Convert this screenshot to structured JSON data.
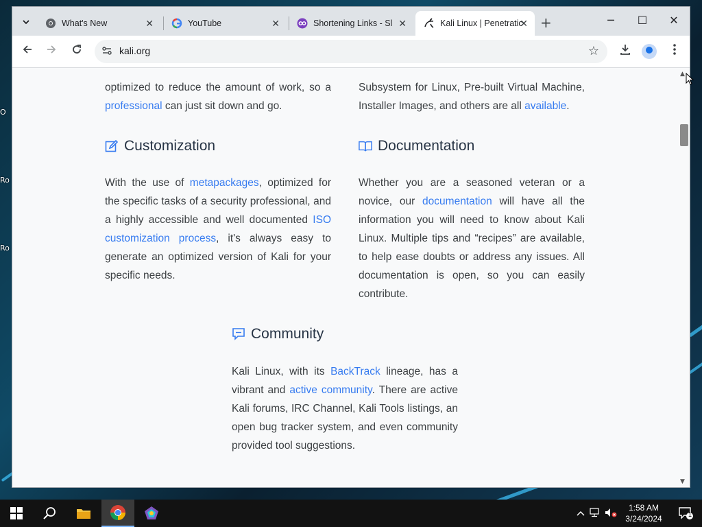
{
  "desktop": {
    "labels": [
      "O",
      "Ro",
      "Ro"
    ]
  },
  "browser": {
    "tabs": [
      {
        "title": "What's New",
        "active": false
      },
      {
        "title": "YouTube",
        "active": false
      },
      {
        "title": "Shortening Links - Sl",
        "active": false
      },
      {
        "title": "Kali Linux | Penetratic",
        "active": true
      }
    ],
    "url": "kali.org"
  },
  "page": {
    "top_left": {
      "lead": "optimized to reduce the amount of work, so a ",
      "link": "professional",
      "tail": " can just sit down and go."
    },
    "top_right": {
      "lead": "Subsystem for Linux, Pre-built Virtual Machine, Installer Images, and others are all ",
      "link": "available",
      "tail": "."
    },
    "customization": {
      "heading": "Customization",
      "p1": "With the use of ",
      "link1": "metapackages",
      "p2": ", optimized for the specific tasks of a security professional, and a highly accessible and well documented ",
      "link2": "ISO customization process",
      "p3": ", it's always easy to generate an optimized version of Kali for your specific needs."
    },
    "documentation": {
      "heading": "Documentation",
      "p1": "Whether you are a seasoned veteran or a novice, our ",
      "link1": "documentation",
      "p2": " will have all the information you will need to know about Kali Linux. Multiple tips and “recipes” are available, to help ease doubts or address any issues. All documentation is open, so you can easily contribute."
    },
    "community": {
      "heading": "Community",
      "p1": "Kali Linux, with its ",
      "link1": "BackTrack",
      "p2": " lineage, has a vibrant and ",
      "link2": "active community",
      "p3": ". There are active Kali forums, IRC Channel, Kali Tools listings, an open bug tracker system, and even community provided tool suggestions."
    }
  },
  "taskbar": {
    "time": "1:58 AM",
    "date": "3/24/2024",
    "notifications": "1"
  },
  "colors": {
    "link": "#367bf0",
    "heading": "#273445",
    "body_text": "#3c4043"
  }
}
